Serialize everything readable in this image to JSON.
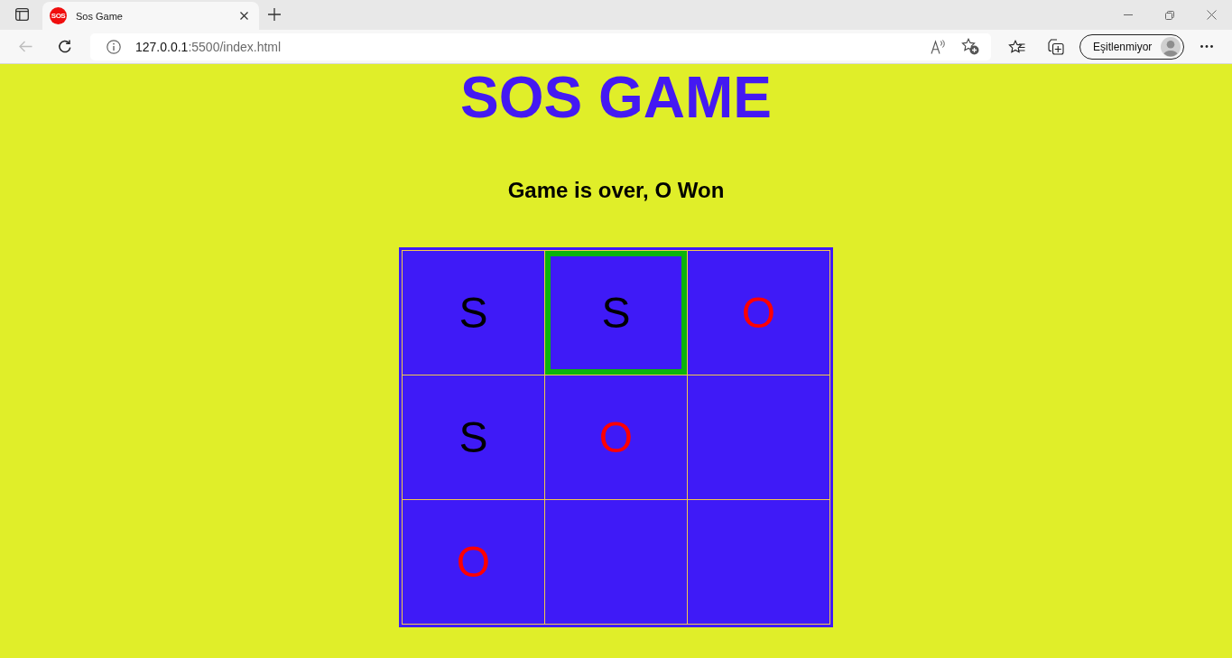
{
  "browser": {
    "tab": {
      "title": "Sos Game",
      "favicon_text": "SOS",
      "selected": true
    },
    "back": {
      "disabled": true
    },
    "address": {
      "host": "127.0.0.1",
      "path": ":5500/index.html"
    },
    "profile": {
      "label": "Eşitlenmiyor"
    }
  },
  "page": {
    "title": "SOS GAME",
    "status": "Game is over, O Won"
  },
  "board": {
    "rows": [
      [
        {
          "mark": "S",
          "color": "#000000",
          "selected": false
        },
        {
          "mark": "S",
          "color": "#000000",
          "selected": true
        },
        {
          "mark": "O",
          "color": "#ff0000",
          "selected": false
        }
      ],
      [
        {
          "mark": "S",
          "color": "#000000",
          "selected": false
        },
        {
          "mark": "O",
          "color": "#ff0000",
          "selected": false
        },
        {
          "selected": false
        }
      ],
      [
        {
          "mark": "O",
          "color": "#ff0000",
          "selected": false
        },
        {
          "selected": false
        },
        {
          "selected": false
        }
      ]
    ]
  }
}
